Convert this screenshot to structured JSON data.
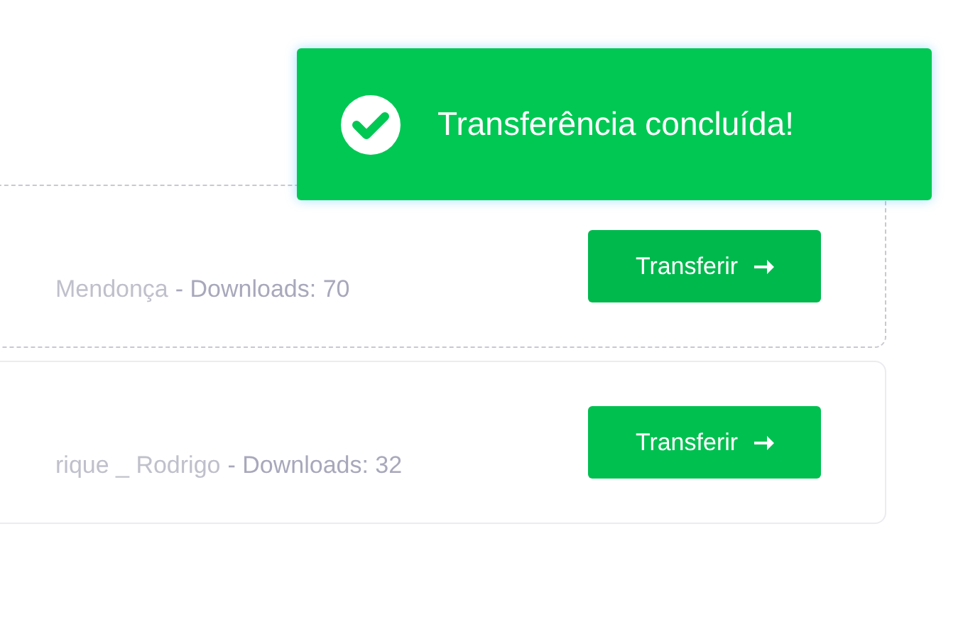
{
  "toast": {
    "message": "Transferência concluída!"
  },
  "files": [
    {
      "author": "Mendonça",
      "downloads": "- Downloads: 70",
      "button": "Transferir",
      "dragging": true
    },
    {
      "author": "rique _ Rodrigo",
      "downloads": "- Downloads: 32",
      "button": "Transferir",
      "dragging": false
    }
  ]
}
